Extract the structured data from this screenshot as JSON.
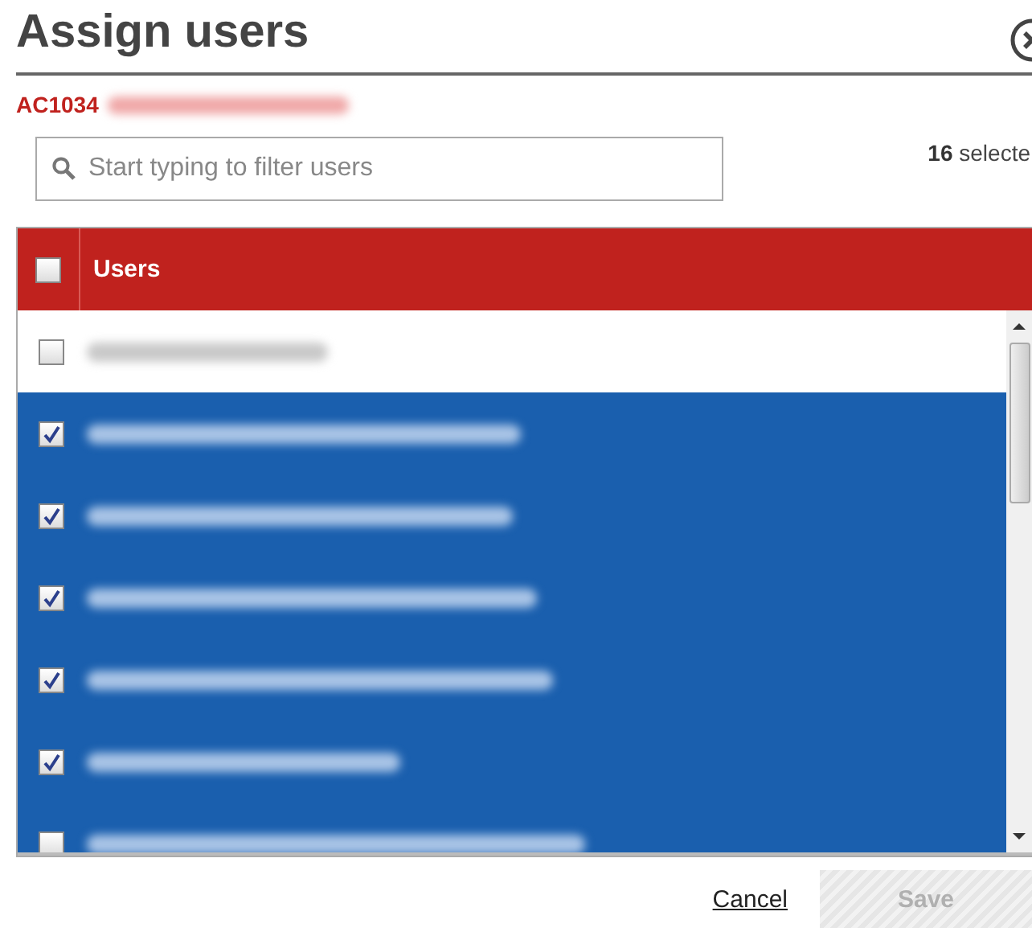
{
  "dialog": {
    "title": "Assign users",
    "subtitle": "AC1034"
  },
  "search": {
    "placeholder": "Start typing to filter users"
  },
  "selection": {
    "count": "16",
    "label": "selecte"
  },
  "table": {
    "header": {
      "label": "Users",
      "checked": false
    },
    "rows": [
      {
        "checked": false,
        "selected": false
      },
      {
        "checked": true,
        "selected": true
      },
      {
        "checked": true,
        "selected": true
      },
      {
        "checked": true,
        "selected": true
      },
      {
        "checked": true,
        "selected": true
      },
      {
        "checked": true,
        "selected": true
      },
      {
        "checked": false,
        "selected": true
      }
    ]
  },
  "buttons": [
    {
      "kind": "link",
      "label": "Cancel",
      "disabled": false
    },
    {
      "kind": "primary",
      "label": "Save",
      "disabled": true
    }
  ]
}
